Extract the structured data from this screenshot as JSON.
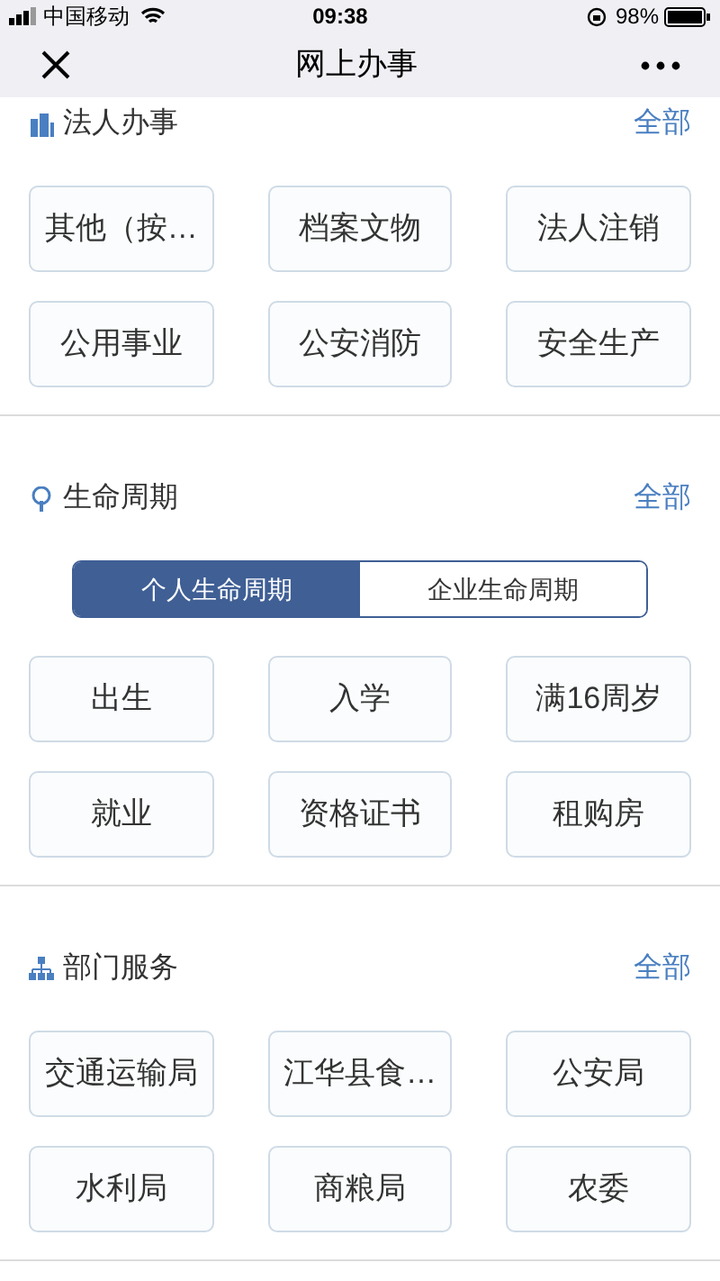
{
  "status_bar": {
    "carrier": "中国移动",
    "time": "09:38",
    "battery": "98%"
  },
  "nav": {
    "title": "网上办事"
  },
  "sections": [
    {
      "title": "法人办事",
      "more": "全部",
      "items": [
        "其他（按…",
        "档案文物",
        "法人注销",
        "公用事业",
        "公安消防",
        "安全生产"
      ]
    },
    {
      "title": "生命周期",
      "more": "全部",
      "tabs": [
        {
          "label": "个人生命周期",
          "selected": true
        },
        {
          "label": "企业生命周期",
          "selected": false
        }
      ],
      "items": [
        "出生",
        "入学",
        "满16周岁",
        "就业",
        "资格证书",
        "租购房"
      ]
    },
    {
      "title": "部门服务",
      "more": "全部",
      "items": [
        "交通运输局",
        "江华县食…",
        "公安局",
        "水利局",
        "商粮局",
        "农委"
      ]
    }
  ]
}
